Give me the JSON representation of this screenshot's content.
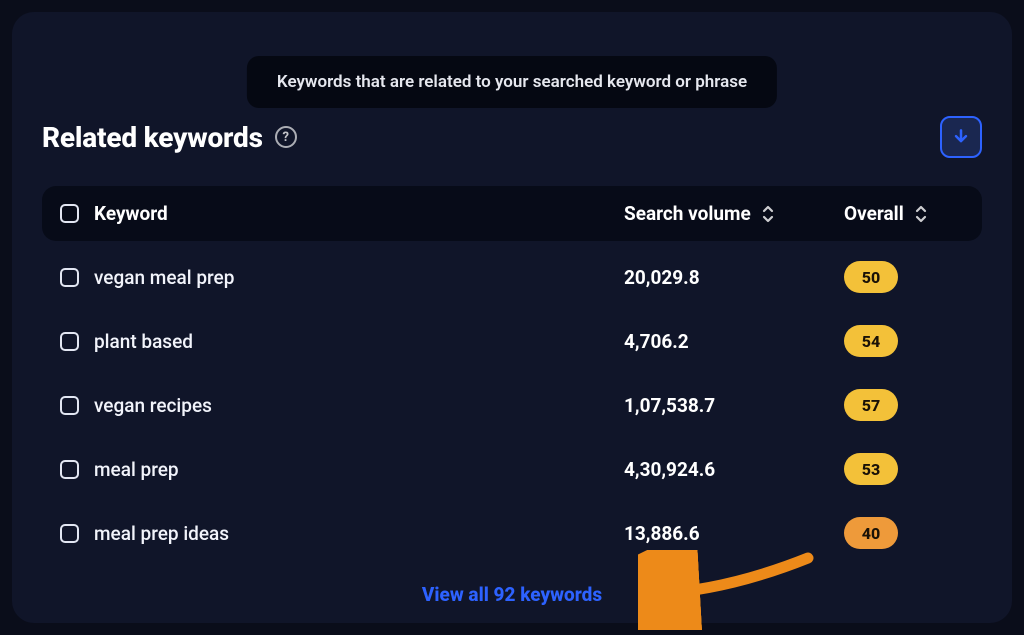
{
  "tooltip": "Keywords that are related to your searched keyword or phrase",
  "section_title": "Related keywords",
  "columns": {
    "keyword": "Keyword",
    "volume": "Search volume",
    "overall": "Overall"
  },
  "rows": [
    {
      "keyword": "vegan meal prep",
      "volume": "20,029.8",
      "overall": "50",
      "tone": "yellow"
    },
    {
      "keyword": "plant based",
      "volume": "4,706.2",
      "overall": "54",
      "tone": "yellow"
    },
    {
      "keyword": "vegan recipes",
      "volume": "1,07,538.7",
      "overall": "57",
      "tone": "yellow"
    },
    {
      "keyword": "meal prep",
      "volume": "4,30,924.6",
      "overall": "53",
      "tone": "yellow"
    },
    {
      "keyword": "meal prep ideas",
      "volume": "13,886.6",
      "overall": "40",
      "tone": "orange"
    }
  ],
  "view_all": "View all 92 keywords",
  "icons": {
    "help": "?",
    "download": "download-icon",
    "sort": "sort-icon"
  },
  "colors": {
    "accent": "#2d62ff",
    "badge_yellow": "#f3c139",
    "badge_orange": "#ee9a3a"
  }
}
